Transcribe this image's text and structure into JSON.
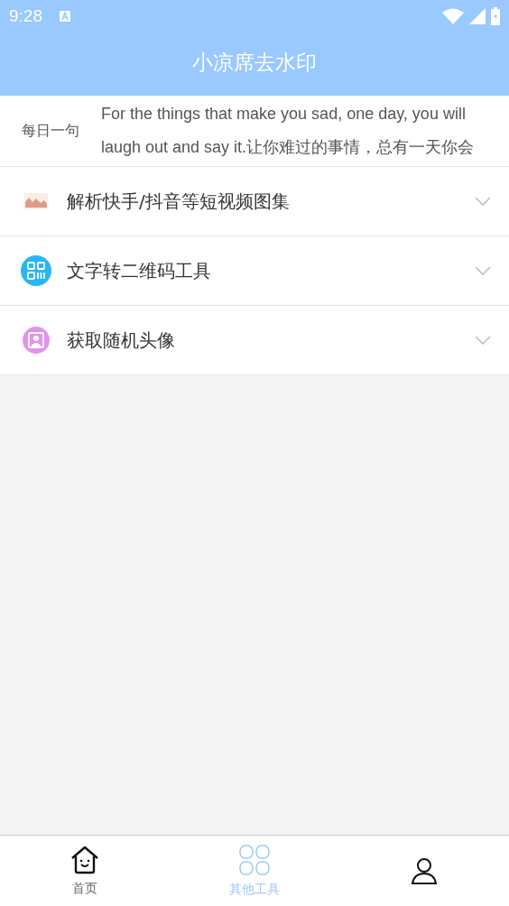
{
  "status_bar": {
    "time": "9:28"
  },
  "header": {
    "title": "小凉席去水印"
  },
  "daily_quote": {
    "label": "每日一句",
    "text": "For the things that make you sad, one day, you will laugh out and say it.让你难过的事情，总有一天你会"
  },
  "tools": [
    {
      "kind": "image",
      "title": "解析快手/抖音等短视频图集",
      "expanded": false
    },
    {
      "kind": "qr",
      "title": "文字转二维码工具",
      "expanded": false
    },
    {
      "kind": "avatar",
      "title": "获取随机头像",
      "expanded": false
    }
  ],
  "tab_bar": [
    {
      "kind": "home",
      "label": "首页",
      "selected": false
    },
    {
      "kind": "grid",
      "label": "其他工具",
      "selected": true
    },
    {
      "kind": "person",
      "selected": false
    }
  ]
}
